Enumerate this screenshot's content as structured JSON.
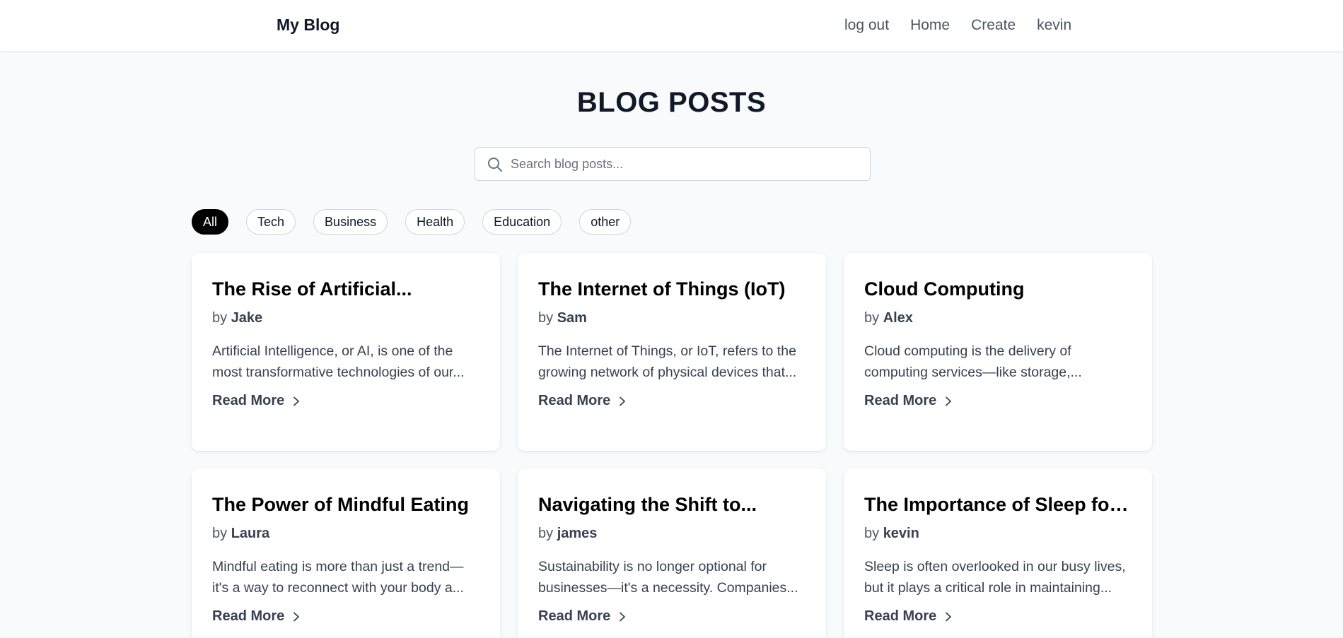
{
  "nav": {
    "brand": "My Blog",
    "links": [
      "log out",
      "Home",
      "Create",
      "kevin"
    ]
  },
  "page": {
    "title": "BLOG POSTS"
  },
  "search": {
    "placeholder": "Search blog posts...",
    "value": "",
    "icon": "search-icon"
  },
  "filters": {
    "items": [
      "All",
      "Tech",
      "Business",
      "Health",
      "Education",
      "other"
    ],
    "active": "All"
  },
  "posts": [
    {
      "title": "The Rise of Artificial...",
      "by": "by",
      "author": "Jake",
      "excerpt": "Artificial Intelligence, or AI, is one of the most transformative technologies of our...",
      "read_more": "Read More"
    },
    {
      "title": "The Internet of Things (IoT)",
      "by": "by",
      "author": "Sam",
      "excerpt": "The Internet of Things, or IoT, refers to the growing network of physical devices that...",
      "read_more": "Read More"
    },
    {
      "title": "Cloud Computing",
      "by": "by",
      "author": "Alex",
      "excerpt": "Cloud computing is the delivery of computing services—like storage,...",
      "read_more": "Read More"
    },
    {
      "title": "The Power of Mindful Eating",
      "by": "by",
      "author": "Laura",
      "excerpt": "Mindful eating is more than just a trend—it's a way to reconnect with your body a...",
      "read_more": "Read More"
    },
    {
      "title": "Navigating the Shift to...",
      "by": "by",
      "author": "james",
      "excerpt": "Sustainability is no longer optional for businesses—it's a necessity. Companies...",
      "read_more": "Read More"
    },
    {
      "title": "The Importance of Sleep for...",
      "by": "by",
      "author": "kevin",
      "excerpt": "Sleep is often overlooked in our busy lives, but it plays a critical role in maintaining...",
      "read_more": "Read More"
    }
  ],
  "colors": {
    "background": "#f9fafb",
    "active_chip": "#000000",
    "text": "#111827",
    "muted": "#4b5563"
  }
}
